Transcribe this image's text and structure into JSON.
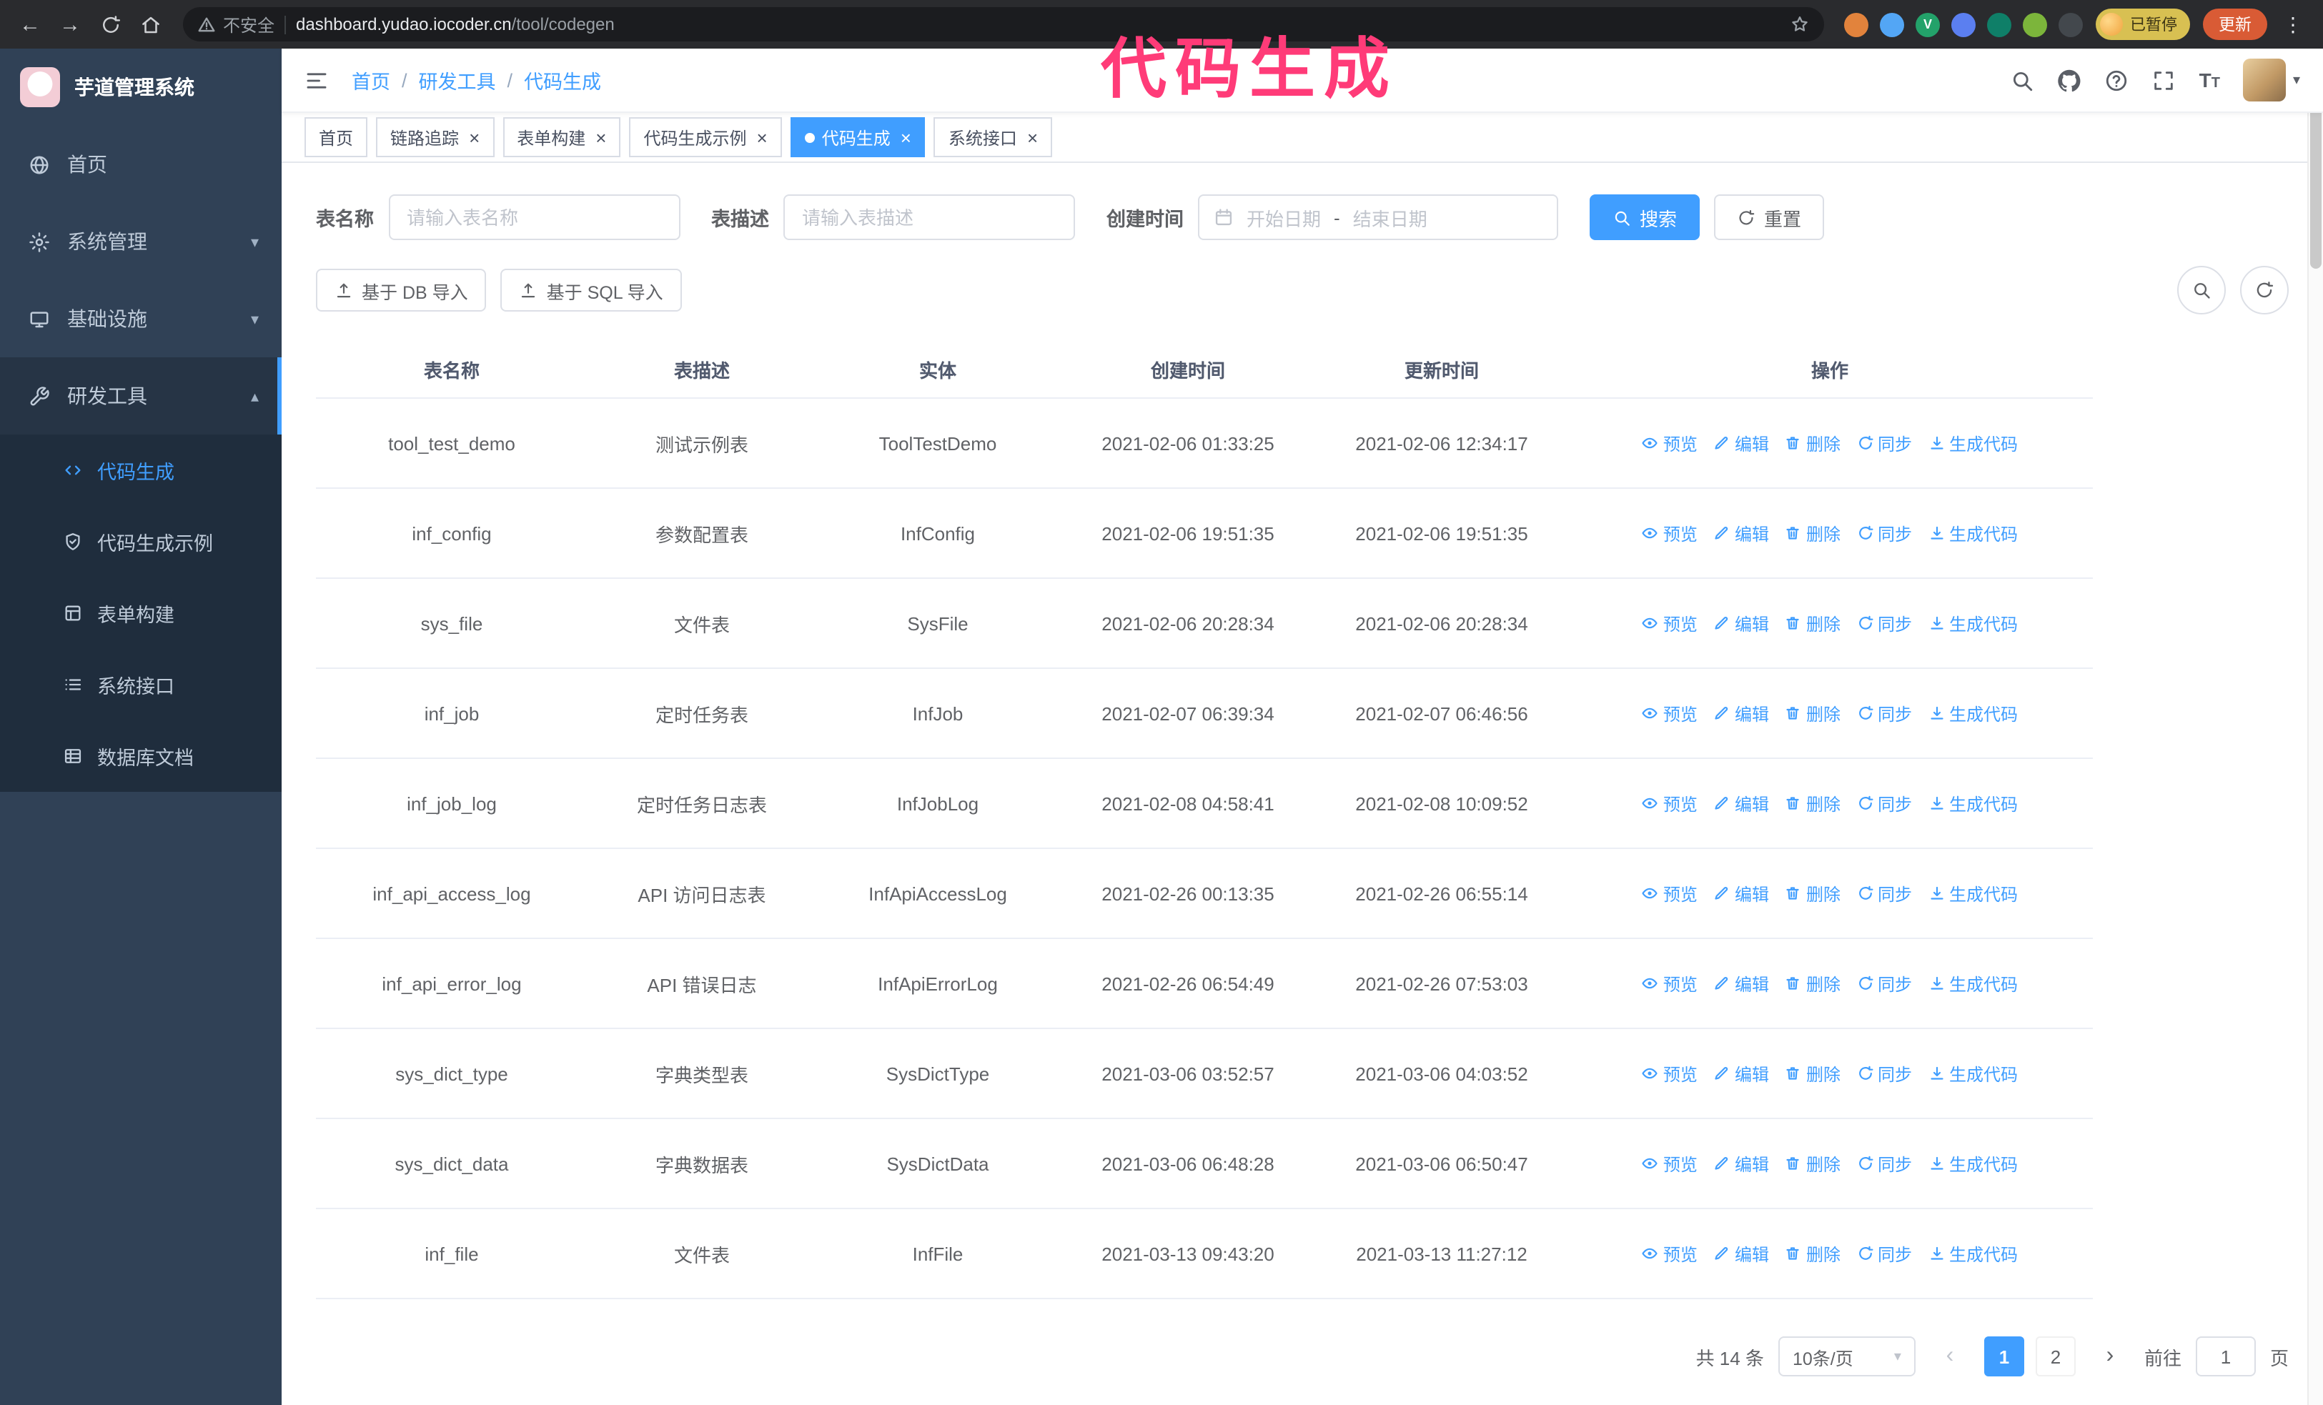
{
  "annotation": {
    "text": "代码生成",
    "color": "#ff3b78"
  },
  "colors": {
    "primary": "#409eff",
    "sidebar_bg": "#304156",
    "submenu_bg": "#1f2d3d"
  },
  "icons": {
    "back": "←",
    "forward": "→",
    "kebab": "⋮",
    "caret_down": "▾",
    "chevron_down": "▾",
    "chevron_up": "▴",
    "select_caret": "▾",
    "prev": "‹",
    "next": "›",
    "font_size": "T"
  },
  "browser": {
    "security_label": "不安全",
    "url_host": "dashboard.yudao.iocoder.cn",
    "url_path": "/tool/codegen",
    "profile_chip": "已暂停",
    "update_button": "更新",
    "extensions": [
      {
        "id": "ext-1",
        "color": "#e2833c",
        "label": ""
      },
      {
        "id": "ext-2",
        "color": "#53a6f5",
        "label": ""
      },
      {
        "id": "ext-3",
        "color": "#23a26a",
        "label": "V"
      },
      {
        "id": "ext-4",
        "color": "#5b7ff0",
        "label": ""
      },
      {
        "id": "ext-5",
        "color": "#0f7f68",
        "label": ""
      },
      {
        "id": "ext-6",
        "color": "#7cb53b",
        "label": ""
      },
      {
        "id": "ext-7",
        "color": "#43484d",
        "label": ""
      }
    ]
  },
  "sidebar": {
    "app_title": "芋道管理系统",
    "menu": [
      {
        "id": "home",
        "label": "首页",
        "icon": "home-icon"
      },
      {
        "id": "system",
        "label": "系统管理",
        "icon": "settings-icon",
        "chevron": "down"
      },
      {
        "id": "infra",
        "label": "基础设施",
        "icon": "server-icon",
        "chevron": "down"
      },
      {
        "id": "devtools",
        "label": "研发工具",
        "icon": "tools-icon",
        "chevron": "up",
        "expanded": true,
        "children": [
          {
            "id": "codegen",
            "label": "代码生成",
            "icon": "code-icon",
            "active": true
          },
          {
            "id": "codegen-example",
            "label": "代码生成示例",
            "icon": "shield-check-icon",
            "active": false
          },
          {
            "id": "form-builder",
            "label": "表单构建",
            "icon": "form-icon",
            "active": false
          },
          {
            "id": "api",
            "label": "系统接口",
            "icon": "api-list-icon",
            "active": false
          },
          {
            "id": "db-doc",
            "label": "数据库文档",
            "icon": "database-icon",
            "active": false
          }
        ]
      }
    ]
  },
  "navbar": {
    "breadcrumb": [
      "首页",
      "研发工具",
      "代码生成"
    ],
    "separator": "/"
  },
  "tabs": [
    {
      "id": "home",
      "label": "首页",
      "closable": false,
      "active": false
    },
    {
      "id": "trace",
      "label": "链路追踪",
      "closable": true,
      "active": false
    },
    {
      "id": "form-builder",
      "label": "表单构建",
      "closable": true,
      "active": false
    },
    {
      "id": "codegen-example",
      "label": "代码生成示例",
      "closable": true,
      "active": false
    },
    {
      "id": "codegen",
      "label": "代码生成",
      "closable": true,
      "active": true
    },
    {
      "id": "api",
      "label": "系统接口",
      "closable": true,
      "active": false
    }
  ],
  "filters": {
    "name_label": "表名称",
    "name_placeholder": "请输入表名称",
    "desc_label": "表描述",
    "desc_placeholder": "请输入表描述",
    "time_label": "创建时间",
    "start_placeholder": "开始日期",
    "range_separator": "-",
    "end_placeholder": "结束日期",
    "search_label": "搜索",
    "reset_label": "重置"
  },
  "toolbar": {
    "import_db": "基于 DB 导入",
    "import_sql": "基于 SQL 导入"
  },
  "table": {
    "headers": [
      "表名称",
      "表描述",
      "实体",
      "创建时间",
      "更新时间",
      "操作"
    ],
    "actions": [
      {
        "id": "preview",
        "label": "预览"
      },
      {
        "id": "edit",
        "label": "编辑"
      },
      {
        "id": "delete",
        "label": "删除"
      },
      {
        "id": "sync",
        "label": "同步"
      },
      {
        "id": "generate",
        "label": "生成代码"
      }
    ],
    "rows": [
      {
        "name": "tool_test_demo",
        "desc": "测试示例表",
        "entity": "ToolTestDemo",
        "created": "2021-02-06 01:33:25",
        "updated": "2021-02-06 12:34:17"
      },
      {
        "name": "inf_config",
        "desc": "参数配置表",
        "entity": "InfConfig",
        "created": "2021-02-06 19:51:35",
        "updated": "2021-02-06 19:51:35"
      },
      {
        "name": "sys_file",
        "desc": "文件表",
        "entity": "SysFile",
        "created": "2021-02-06 20:28:34",
        "updated": "2021-02-06 20:28:34"
      },
      {
        "name": "inf_job",
        "desc": "定时任务表",
        "entity": "InfJob",
        "created": "2021-02-07 06:39:34",
        "updated": "2021-02-07 06:46:56"
      },
      {
        "name": "inf_job_log",
        "desc": "定时任务日志表",
        "entity": "InfJobLog",
        "created": "2021-02-08 04:58:41",
        "updated": "2021-02-08 10:09:52"
      },
      {
        "name": "inf_api_access_log",
        "desc": "API 访问日志表",
        "entity": "InfApiAccessLog",
        "created": "2021-02-26 00:13:35",
        "updated": "2021-02-26 06:55:14"
      },
      {
        "name": "inf_api_error_log",
        "desc": "API 错误日志",
        "entity": "InfApiErrorLog",
        "created": "2021-02-26 06:54:49",
        "updated": "2021-02-26 07:53:03"
      },
      {
        "name": "sys_dict_type",
        "desc": "字典类型表",
        "entity": "SysDictType",
        "created": "2021-03-06 03:52:57",
        "updated": "2021-03-06 04:03:52"
      },
      {
        "name": "sys_dict_data",
        "desc": "字典数据表",
        "entity": "SysDictData",
        "created": "2021-03-06 06:48:28",
        "updated": "2021-03-06 06:50:47"
      },
      {
        "name": "inf_file",
        "desc": "文件表",
        "entity": "InfFile",
        "created": "2021-03-13 09:43:20",
        "updated": "2021-03-13 11:27:12"
      }
    ]
  },
  "pagination": {
    "total": "共 14 条",
    "page_size": "10条/页",
    "pages": [
      {
        "label": "1",
        "active": true
      },
      {
        "label": "2",
        "active": false
      }
    ],
    "goto_label": "前往",
    "goto_value": "1",
    "unit_label": "页"
  }
}
